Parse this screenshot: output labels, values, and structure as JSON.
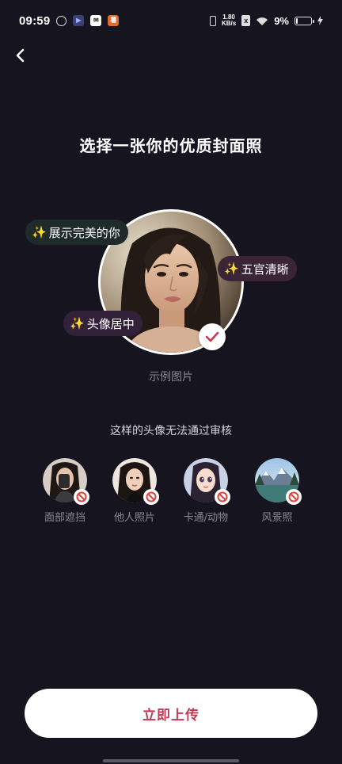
{
  "status_bar": {
    "time": "09:59",
    "speed_value": "1.80",
    "speed_unit": "KB/s",
    "battery_percent": "9%",
    "battery_level": 0.09,
    "icons": [
      "app-icon-1",
      "app-icon-2",
      "mail-icon",
      "app-icon-4",
      "vibrate-icon",
      "sim-off-icon",
      "wifi-icon",
      "battery-icon",
      "charging-icon"
    ]
  },
  "header": {
    "back_icon": "chevron-left-icon",
    "title": "选择一张你的优质封面照"
  },
  "example": {
    "tags": [
      "展示完美的你",
      "五官清晰",
      "头像居中"
    ],
    "tag_prefix": "✨",
    "caption": "示例图片",
    "check_icon": "check-icon"
  },
  "rejected": {
    "title": "这样的头像无法通过审核",
    "items": [
      {
        "label": "面部遮挡",
        "icon": "no-entry-icon"
      },
      {
        "label": "他人照片",
        "icon": "no-entry-icon"
      },
      {
        "label": "卡通/动物",
        "icon": "no-entry-icon"
      },
      {
        "label": "风景照",
        "icon": "no-entry-icon"
      }
    ]
  },
  "actions": {
    "upload_label": "立即上传"
  },
  "colors": {
    "background": "#16141f",
    "accent": "#c33a55",
    "tag_spark": "#ffc83d"
  }
}
